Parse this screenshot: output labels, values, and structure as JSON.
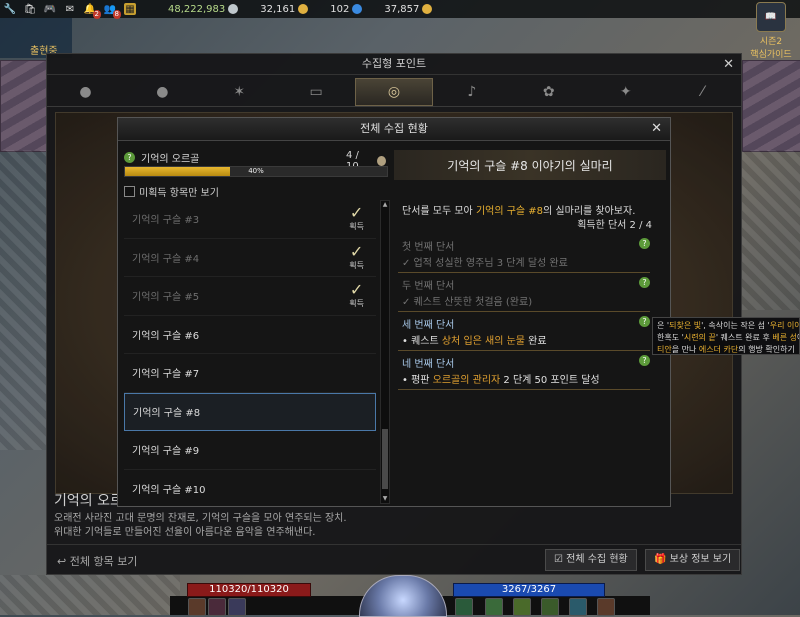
{
  "topbar": {
    "badges": [
      "2",
      "8"
    ],
    "currencies": [
      {
        "value": "48,222,983",
        "color": "#bfc7cc",
        "icon": "silver-coin-icon"
      },
      {
        "value": "32,161",
        "color": "#e0b040",
        "icon": "gold-coin-icon"
      },
      {
        "value": "102",
        "color": "#3a8ae0",
        "icon": "crystal-icon"
      },
      {
        "value": "37,857",
        "color": "#e0b040",
        "icon": "pheon-icon"
      }
    ]
  },
  "location": {
    "status": "출현중"
  },
  "guide": {
    "line1": "시즌2",
    "line2": "핵심가이드"
  },
  "main_window": {
    "title": "수집형 포인트",
    "tabs": [
      "island-soul-icon",
      "giant-heart-icon",
      "star-icon",
      "painting-icon",
      "orpheus-icon",
      "seed-icon",
      "mokoko-icon",
      "compass-icon",
      "world-tree-icon"
    ],
    "active_tab": 4,
    "desc_title": "기억의 오르",
    "desc_line1": "오래전 사라진 고대 문명의 잔재로, 기억의 구슬을 모아 연주되는 장치.",
    "desc_line2": "위대한 기억들로 만들어진 선율이 아름다운 음악을 연주해낸다.",
    "all_items": "전체 항목 보기",
    "btn_status": "전체 수집 현황",
    "btn_reward": "보상 정보 보기"
  },
  "dialog": {
    "title": "전체 수집 현황",
    "collection_name": "기억의 오르골",
    "count": "4 / 10",
    "progress_pct": 40,
    "progress_label": "40%",
    "unacquired_only": "미획득 항목만 보기",
    "acquired_label": "획득",
    "items": [
      {
        "name": "기억의 구슬 #3",
        "acquired": true
      },
      {
        "name": "기억의 구슬 #4",
        "acquired": true
      },
      {
        "name": "기억의 구슬 #5",
        "acquired": true
      },
      {
        "name": "기억의 구슬 #6",
        "acquired": false
      },
      {
        "name": "기억의 구슬 #7",
        "acquired": false
      },
      {
        "name": "기억의 구슬 #8",
        "acquired": false,
        "selected": true
      },
      {
        "name": "기억의 구슬 #9",
        "acquired": false
      },
      {
        "name": "기억의 구슬 #10",
        "acquired": false
      }
    ],
    "detail": {
      "heading": "기억의 구슬 #8 이야기의 실마리",
      "intro_pre": "단서를 모두 모아 ",
      "intro_hl": "기억의 구슬 #8",
      "intro_post": "의 실마리를 찾아보자.",
      "found": "획득한 단서 2 / 4",
      "clues": [
        {
          "title": "첫 번째 단서",
          "desc": "✓ 업적 성실한 영주님 3 단계 달성 완료",
          "done": true
        },
        {
          "title": "두 번째 단서",
          "desc": "✓ 퀘스트 산뜻한 첫걸음 (완료)",
          "done": true
        },
        {
          "title": "세 번째 단서",
          "pre": "• 퀘스트 ",
          "hl": "상처 입은 새의 눈물",
          "post": " 완료",
          "done": false
        },
        {
          "title": "네 번째 단서",
          "pre": "• 평판 ",
          "hl": "오르골의 관리자",
          "post": " 2 단계 50 포인트 달성",
          "done": false
        }
      ]
    }
  },
  "tooltip": {
    "l1a": "은 '",
    "l1b": "되찾은 빛",
    "l1c": "', 속삭이는 작은 섬 '",
    "l1d": "우리 이야기",
    "l2a": "한혹도 '",
    "l2b": "시련의 끝",
    "l2c": "' 퀘스트 완료 후 ",
    "l2d": "베른 성",
    "l2e": "에서",
    "l3a": "티안",
    "l3b": "을 만나 ",
    "l3c": "에스더 카단",
    "l3d": "의 행방 확인하기"
  },
  "hud": {
    "hp": "110320/110320",
    "mp": "3267/3267"
  }
}
